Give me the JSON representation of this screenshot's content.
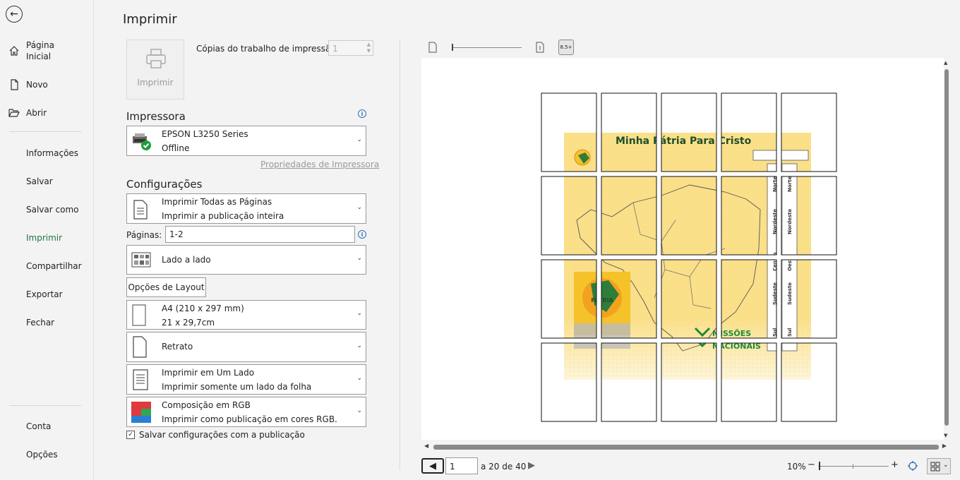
{
  "title": "Imprimir",
  "nav": {
    "items": [
      {
        "label": "Página Inicial",
        "icon": "home-icon"
      },
      {
        "label": "Novo",
        "icon": "new-document-icon"
      },
      {
        "label": "Abrir",
        "icon": "open-folder-icon"
      },
      {
        "label": "Informações"
      },
      {
        "label": "Salvar"
      },
      {
        "label": "Salvar como"
      },
      {
        "label": "Imprimir",
        "active": true
      },
      {
        "label": "Compartilhar"
      },
      {
        "label": "Exportar"
      },
      {
        "label": "Fechar"
      },
      {
        "label": "Conta"
      },
      {
        "label": "Opções"
      }
    ]
  },
  "print": {
    "button_label": "Imprimir",
    "copies_label": "Cópias do trabalho de impressão:",
    "copies_value": "1"
  },
  "printer": {
    "heading": "Impressora",
    "name": "EPSON L3250 Series",
    "status": "Offline",
    "properties_link": "Propriedades de Impressora"
  },
  "settings": {
    "heading": "Configurações",
    "range": {
      "line1": "Imprimir Todas as Páginas",
      "line2": "Imprimir a publicação inteira"
    },
    "pages_label": "Páginas:",
    "pages_value": "1-2",
    "layout": {
      "line1": "Lado a lado"
    },
    "layout_options": "Opções de Layout",
    "paper": {
      "line1": "A4 (210 x 297 mm)",
      "line2": "21 x 29,7cm"
    },
    "orientation": {
      "line1": "Retrato"
    },
    "sides": {
      "line1": "Imprimir em Um Lado",
      "line2": "Imprimir somente um lado da folha"
    },
    "color": {
      "line1": "Composição em RGB",
      "line2": "Imprimir como publicação em cores RGB."
    },
    "save_settings": "Salvar configurações com a publicação",
    "save_settings_checked": true
  },
  "preview": {
    "toolbar_badge": "8.5+",
    "poster_title": "Minha Pátria Para Cristo",
    "poster_brand_line1": "MISSÕES",
    "poster_brand_line2": "NACIONAIS",
    "region_labels": [
      "Norte",
      "Nordeste",
      "Centro",
      "Oeste",
      "Sudeste",
      "Sul"
    ],
    "current_page": "1",
    "page_total": "a 20 de 40",
    "zoom": "10%",
    "minus": "−",
    "plus": "+",
    "colors": {
      "poster_bg": "#fbe08a",
      "poster_text": "#1f4f2a",
      "accent": "#217346"
    }
  }
}
